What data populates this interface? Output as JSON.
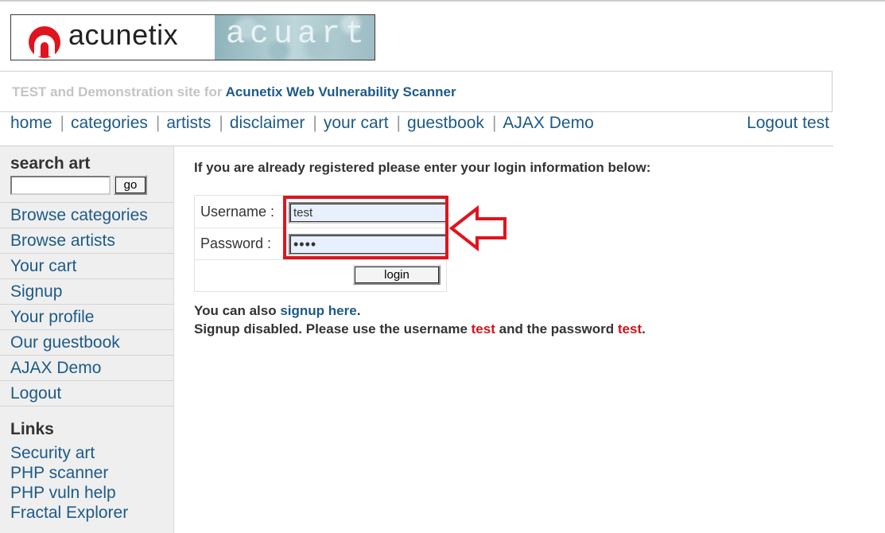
{
  "logo": {
    "brand": "acunetix",
    "product": "acuart"
  },
  "banner": {
    "prefix": "TEST and Demonstration site for",
    "link": "Acunetix Web Vulnerability Scanner"
  },
  "topnav": {
    "items": [
      "home",
      "categories",
      "artists",
      "disclaimer",
      "your cart",
      "guestbook",
      "AJAX Demo"
    ],
    "logout": "Logout test"
  },
  "sidebar": {
    "search_title": "search art",
    "search_value": "",
    "go_label": "go",
    "menu": [
      "Browse categories",
      "Browse artists",
      "Your cart",
      "Signup",
      "Your profile",
      "Our guestbook",
      "AJAX Demo",
      "Logout"
    ],
    "links_title": "Links",
    "links": [
      "Security art",
      "PHP scanner",
      "PHP vuln help",
      "Fractal Explorer"
    ]
  },
  "main": {
    "intro": "If you are already registered please enter your login information below:",
    "username_label": "Username :",
    "username_value": "test",
    "password_label": "Password :",
    "password_value": "••••",
    "login_label": "login",
    "signup_prefix": "You can also",
    "signup_link": "signup here",
    "signup_suffix": ".",
    "disabled_a": "Signup disabled. Please use the username",
    "disabled_user": "test",
    "disabled_b": "and the password",
    "disabled_pass": "test",
    "disabled_end": "."
  },
  "colors": {
    "link": "#1d5a88",
    "highlight": "#e0141e",
    "sidebar": "#efefef"
  }
}
